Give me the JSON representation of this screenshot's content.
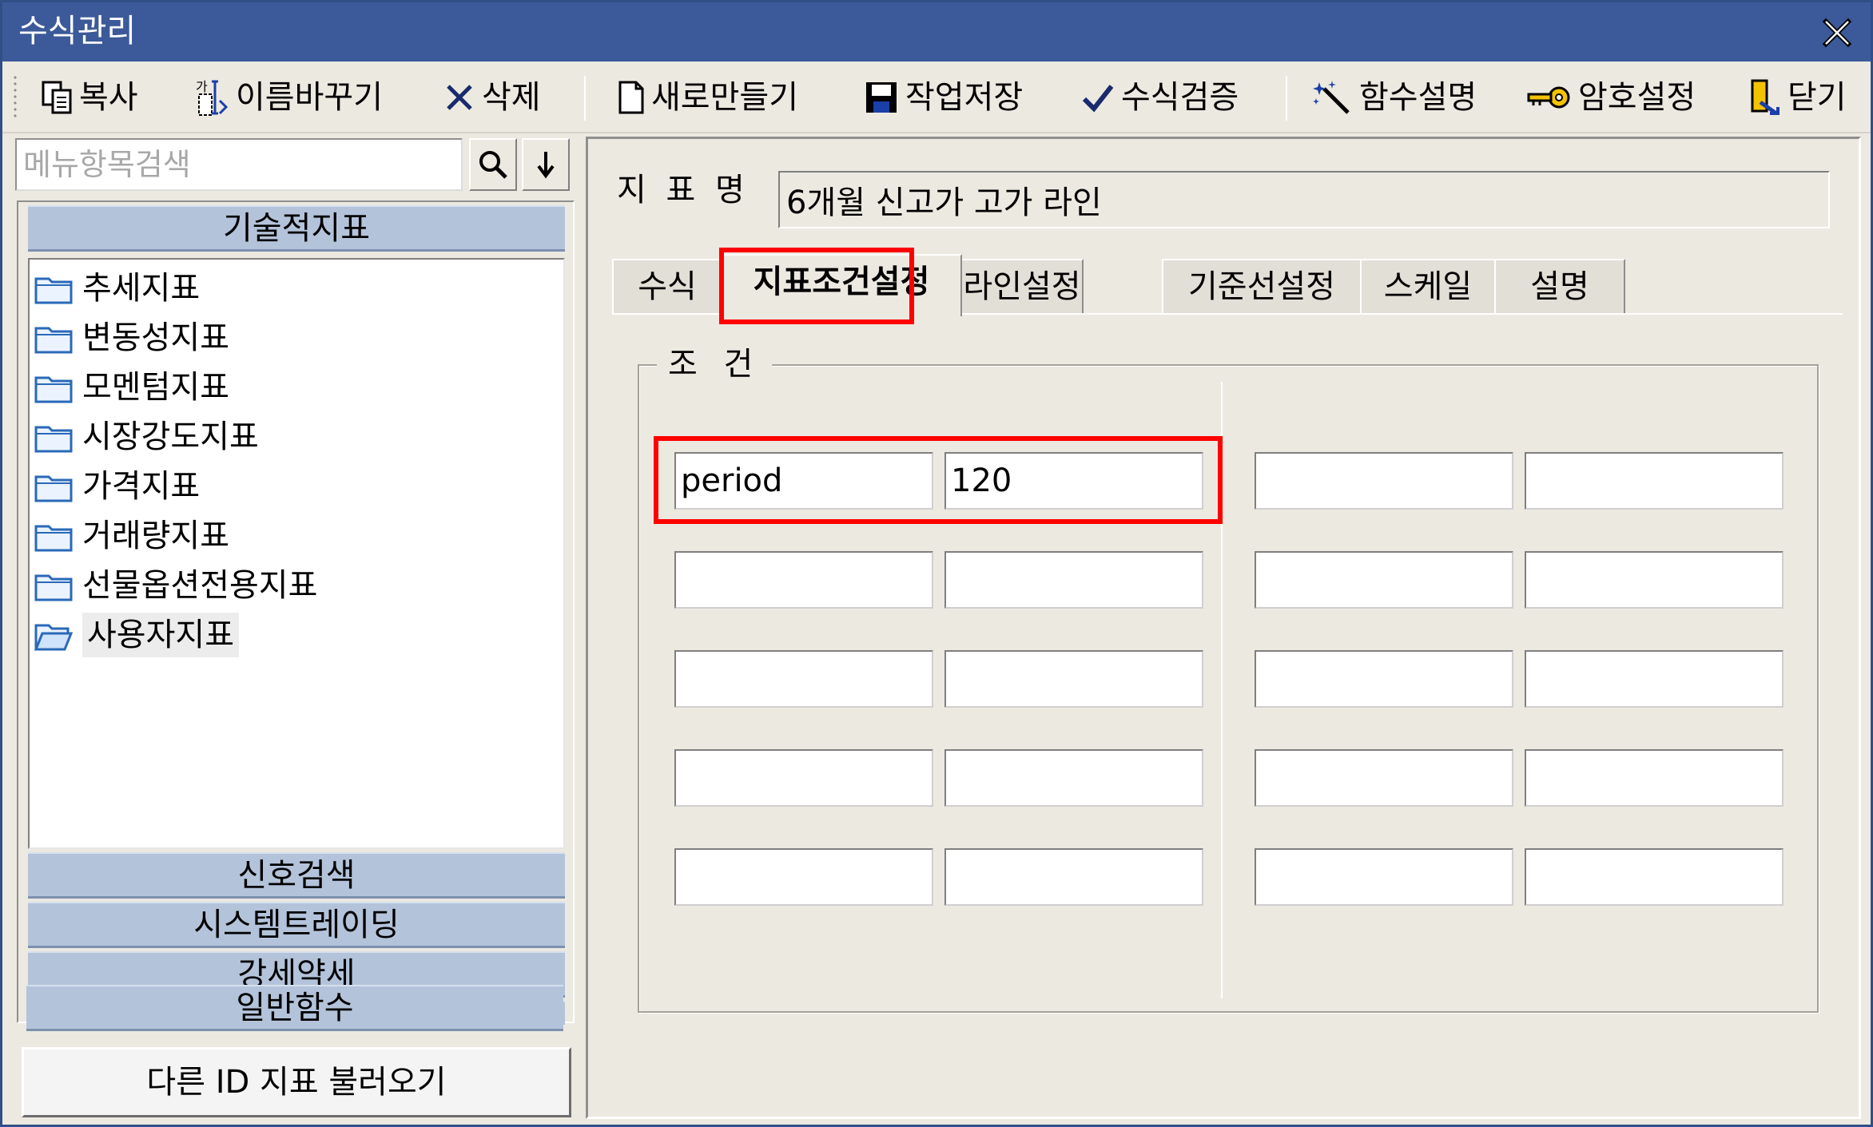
{
  "window": {
    "title": "수식관리"
  },
  "toolbar": {
    "copy": "복사",
    "rename": "이름바꾸기",
    "delete": "삭제",
    "new": "새로만들기",
    "save": "작업저장",
    "verify": "수식검증",
    "func_desc": "함수설명",
    "password": "암호설정",
    "close": "닫기"
  },
  "sidebar": {
    "search_placeholder": "메뉴항목검색",
    "category_top": "기술적지표",
    "tree_items": [
      {
        "label": "추세지표"
      },
      {
        "label": "변동성지표"
      },
      {
        "label": "모멘텀지표"
      },
      {
        "label": "시장강도지표"
      },
      {
        "label": "가격지표"
      },
      {
        "label": "거래량지표"
      },
      {
        "label": "선물옵션전용지표"
      },
      {
        "label": "사용자지표"
      }
    ],
    "categories_bottom": [
      "신호검색",
      "시스템트레이딩",
      "강세약세",
      "일반함수"
    ],
    "load_button": "다른 ID 지표 불러오기"
  },
  "main": {
    "indicator_label": "지 표 명",
    "indicator_name": "6개월 신고가 고가 라인",
    "tabs": [
      "수식",
      "지표조건설정",
      "라인설정",
      "기준선설정",
      "스케일",
      "설명"
    ],
    "active_tab": "지표조건설정",
    "condition_group_title": "조 건",
    "conditions": {
      "left": [
        {
          "name": "period",
          "value": "120"
        },
        {
          "name": "",
          "value": ""
        },
        {
          "name": "",
          "value": ""
        },
        {
          "name": "",
          "value": ""
        },
        {
          "name": "",
          "value": ""
        }
      ],
      "right": [
        {
          "name": "",
          "value": ""
        },
        {
          "name": "",
          "value": ""
        },
        {
          "name": "",
          "value": ""
        },
        {
          "name": "",
          "value": ""
        },
        {
          "name": "",
          "value": ""
        }
      ]
    }
  },
  "colors": {
    "titlebar": "#3c5a99",
    "category_bar": "#b3c3da",
    "highlight": "#ff0000"
  }
}
